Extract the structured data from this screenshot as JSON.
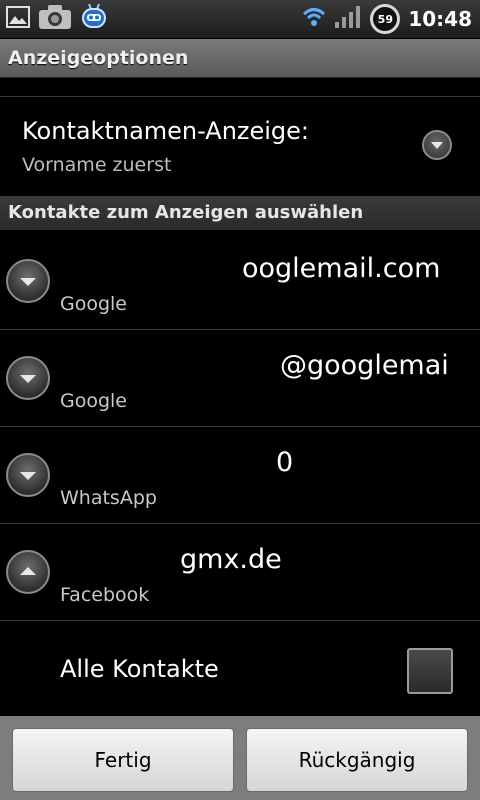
{
  "status_bar": {
    "time": "10:48",
    "battery_level": "59",
    "icons": [
      "picture-icon",
      "camera-icon",
      "robot-icon",
      "wifi-icon",
      "signal-icon",
      "battery-icon"
    ]
  },
  "title_bar": {
    "title": "Anzeigeoptionen"
  },
  "display_pref": {
    "title": "Kontaktnamen-Anzeige:",
    "summary": "Vorname zuerst"
  },
  "section": {
    "header": "Kontakte zum Anzeigen auswählen"
  },
  "accounts": [
    {
      "name": "ooglemail.com",
      "type": "Google",
      "expanded": false
    },
    {
      "name": "@googlemai",
      "type": "Google",
      "expanded": false
    },
    {
      "name": "0",
      "type": "WhatsApp",
      "expanded": false
    },
    {
      "name": "gmx.de",
      "type": "Facebook",
      "expanded": true
    }
  ],
  "all_contacts": {
    "label": "Alle Kontakte",
    "checked": false
  },
  "buttons": {
    "done": "Fertig",
    "revert": "Rückgängig"
  }
}
